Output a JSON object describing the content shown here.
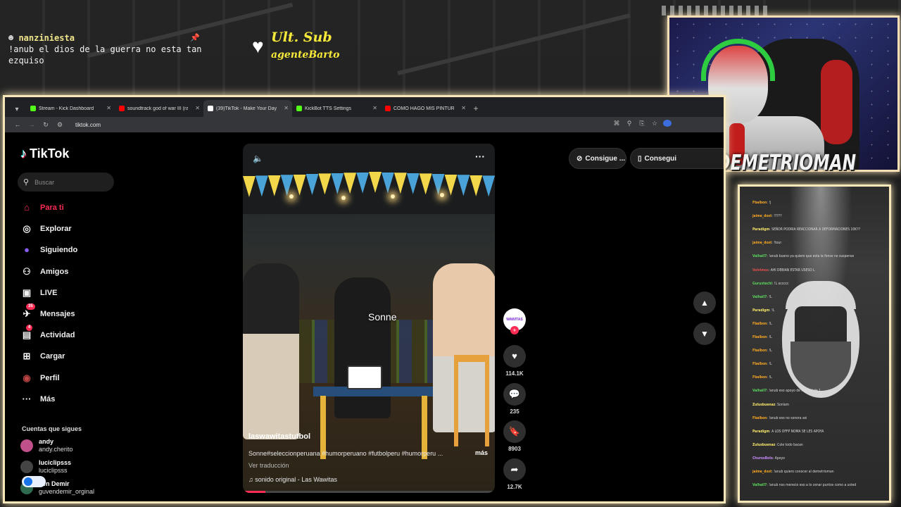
{
  "overlay": {
    "chat_user": "nanziniesta",
    "chat_text": "!anub el dios de la guerra no esta tan ezquiso",
    "sub_title": "Ult. Sub",
    "sub_name": "agenteBarto",
    "streamer_name": "DEMETRIOMAN"
  },
  "browser": {
    "tabs": [
      {
        "label": "Stream - Kick Dashboard",
        "color": "#53fc18"
      },
      {
        "label": "soundtrack god of war III (rag",
        "color": "#ff0000"
      },
      {
        "label": "(39)TikTok - Make Your Day",
        "color": "#ffffff",
        "active": true
      },
      {
        "label": "KickBot TTS Settings",
        "color": "#53fc18"
      },
      {
        "label": "COMO HAGO MIS PINTURAS D",
        "color": "#ff0000"
      }
    ],
    "url": "tiktok.com"
  },
  "tiktok": {
    "logo": "TikTok",
    "search_placeholder": "Buscar",
    "nav": [
      {
        "label": "Para ti",
        "icon": "home-icon",
        "active": true
      },
      {
        "label": "Explorar",
        "icon": "compass-icon"
      },
      {
        "label": "Siguiendo",
        "icon": "following-icon"
      },
      {
        "label": "Amigos",
        "icon": "friends-icon"
      },
      {
        "label": "LIVE",
        "icon": "live-icon"
      },
      {
        "label": "Mensajes",
        "icon": "messages-icon",
        "badge": "35"
      },
      {
        "label": "Actividad",
        "icon": "activity-icon",
        "badge": "4"
      },
      {
        "label": "Cargar",
        "icon": "upload-icon"
      },
      {
        "label": "Perfil",
        "icon": "profile-icon"
      },
      {
        "label": "Más",
        "icon": "more-icon"
      }
    ],
    "following_title": "Cuentas que sigues",
    "following": [
      {
        "name": "andy",
        "handle": "andy.cherito"
      },
      {
        "name": "luciclipsss",
        "handle": "luciclipsss"
      },
      {
        "name": "ven Demir",
        "handle": "guvendemir_orginal"
      }
    ],
    "get_buttons": [
      "Consigue ...",
      "Consegui"
    ],
    "video": {
      "caption": "Sonne",
      "author": "laswawitastutbol",
      "description": "Sonne#seleccionperuana #humorperuano #futbolperu #humorperu ...",
      "more": "más",
      "translate": "Ver traducción",
      "sound": "sonido original - Las Wawitas",
      "progress": 0.09
    },
    "actions": {
      "avatar_label": "WAWITAS",
      "likes": "114.1K",
      "comments": "235",
      "saves": "8903",
      "shares": "12.7K"
    }
  },
  "side_chat": [
    {
      "user": "Fbalbon",
      "msg": "!j",
      "color": "#f5a623"
    },
    {
      "user": "jaime_dost",
      "msg": "!????",
      "color": "#f5a623"
    },
    {
      "user": "Paradigm",
      "msg": "SEÑOR PODRIA REACCIONAR A DEFORMACIONES 10K??",
      "color": "#f5e56b"
    },
    {
      "user": "jaime_dost",
      "msg": "!tour",
      "color": "#f5a623"
    },
    {
      "user": "Valhall7",
      "msg": "!anub bueno ya quiero que esta la fonso no suspense",
      "color": "#5bd45b"
    },
    {
      "user": "Volvimos",
      "msg": "AHI DEBIAN ESTAR USESO L",
      "color": "#e24d4d"
    },
    {
      "user": "Guruxtechl",
      "msg": "!L xccccc",
      "color": "#5bd45b"
    },
    {
      "user": "Valhall7",
      "msg": "!L",
      "color": "#5bd45b"
    },
    {
      "user": "Paradigm",
      "msg": "!L",
      "color": "#f5e56b"
    },
    {
      "user": "Fbalbon",
      "msg": "!L",
      "color": "#f5a623"
    },
    {
      "user": "Fbalbon",
      "msg": "!L",
      "color": "#f5a623"
    },
    {
      "user": "Fbalbon",
      "msg": "!L",
      "color": "#f5a623"
    },
    {
      "user": "Fbalbon",
      "msg": "!L",
      "color": "#f5a623"
    },
    {
      "user": "Fbalbon",
      "msg": "!L",
      "color": "#f5a623"
    },
    {
      "user": "Valhall7",
      "msg": "!anub eso apoyo de los god de 1",
      "color": "#5bd45b"
    },
    {
      "user": "Zulusbuenaz",
      "msg": "Sonlam",
      "color": "#f5e56b"
    },
    {
      "user": "Fbalbon",
      "msg": "!anub eso no sonora asi",
      "color": "#f5a623"
    },
    {
      "user": "Paradigm",
      "msg": "A LOS OFFP NOMA SE LES APOYA",
      "color": "#f5e56b"
    },
    {
      "user": "Zulusbuenaz",
      "msg": "Cole todo bacan",
      "color": "#f5e56b"
    },
    {
      "user": "ChurosBolo",
      "msg": "Apoyo",
      "color": "#c58af9"
    },
    {
      "user": "jaime_dost",
      "msg": "!anub quiero conocer al demetrioman",
      "color": "#f5a623"
    },
    {
      "user": "Valhall7",
      "msg": "!anub nos merecio eso a lo cenar puntos como a usted",
      "color": "#5bd45b"
    }
  ]
}
